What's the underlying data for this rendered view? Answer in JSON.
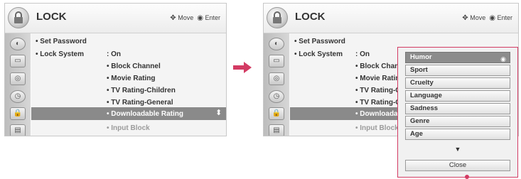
{
  "left_panel": {
    "title": "LOCK",
    "hint_move": "Move",
    "hint_enter": "Enter",
    "items": [
      {
        "label": "Set Password",
        "value": ""
      },
      {
        "label": "Lock System",
        "value": ": On"
      }
    ],
    "sub_items": [
      "Block Channel",
      "Movie Rating",
      "TV Rating-Children",
      "TV Rating-General",
      "Downloadable Rating",
      "Input Block"
    ]
  },
  "right_panel": {
    "title": "LOCK",
    "hint_move": "Move",
    "hint_enter": "Enter",
    "items": [
      {
        "label": "Set Password",
        "value": ""
      },
      {
        "label": "Lock System",
        "value": ": On"
      }
    ],
    "sub_items": [
      "Block Chann",
      "Movie Ratin",
      "TV Rating-C",
      "TV Rating-G",
      "Downloadab",
      "Input Block"
    ]
  },
  "popup": {
    "options": [
      "Humor",
      "Sport",
      "Cruelty",
      "Language",
      "Sadness",
      "Genre",
      "Age"
    ],
    "selected": "Humor",
    "more_indicator": "▼",
    "close_label": "Close"
  },
  "colors": {
    "highlight": "#8a8a8a",
    "accent_arrow": "#d33b63"
  }
}
